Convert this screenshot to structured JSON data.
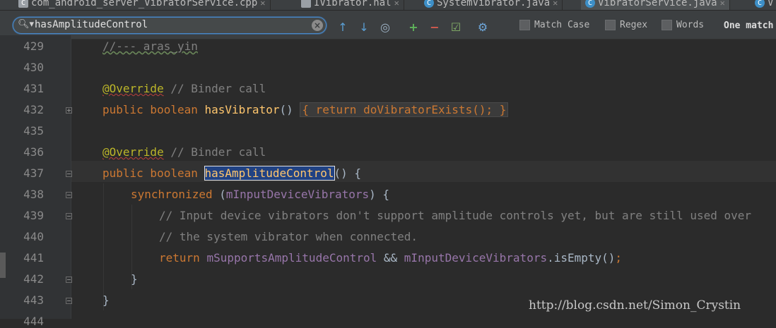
{
  "tabs": [
    {
      "label": "com_android_server_VibratorService.cpp",
      "icon": "cpp-file-icon"
    },
    {
      "label": "IVibrator.hal",
      "icon": "text-file-icon"
    },
    {
      "label": "SystemVibrator.java",
      "icon": "java-class-icon"
    },
    {
      "label": "VibratorService.java",
      "icon": "java-class-icon",
      "active": true
    },
    {
      "label": "V",
      "icon": "java-class-icon"
    }
  ],
  "search": {
    "query": "hasAmplitudeControl",
    "options": {
      "match_case": "Match Case",
      "regex": "Regex",
      "words": "Words"
    },
    "status": "One match"
  },
  "editor": {
    "line_numbers": [
      "429",
      "430",
      "431",
      "432",
      "435",
      "436",
      "437",
      "438",
      "439",
      "440",
      "441",
      "442",
      "443",
      "444"
    ],
    "lines": {
      "l429": "//--- aras_yin",
      "l431_annotation": "@Override",
      "l431_comment": " // Binder call",
      "l432_kw": "public boolean ",
      "l432_fn": "hasVibrator",
      "l432_rest": "() ",
      "l432_fold": "{ return doVibratorExists(); }",
      "l436_annotation": "@Override",
      "l436_comment": " // Binder call",
      "l437_kw": "public boolean ",
      "l437_fn": "hasAmplitudeControl",
      "l437_rest": "() {",
      "l438_kw": "synchronized",
      "l438_open": " (",
      "l438_field": "mInputDeviceVibrators",
      "l438_rest": ") {",
      "l439": "// Input device vibrators don't support amplitude controls yet, but are still used over",
      "l440": "// the system vibrator when connected.",
      "l441_kw": "return ",
      "l441_f1": "mSupportsAmplitudeControl",
      "l441_op": " && ",
      "l441_f2": "mInputDeviceVibrators",
      "l441_call": ".isEmpty()",
      "l441_semi": ";",
      "l442": "}",
      "l443": "}"
    }
  },
  "watermark": "http://blog.csdn.net/Simon_Crystin"
}
